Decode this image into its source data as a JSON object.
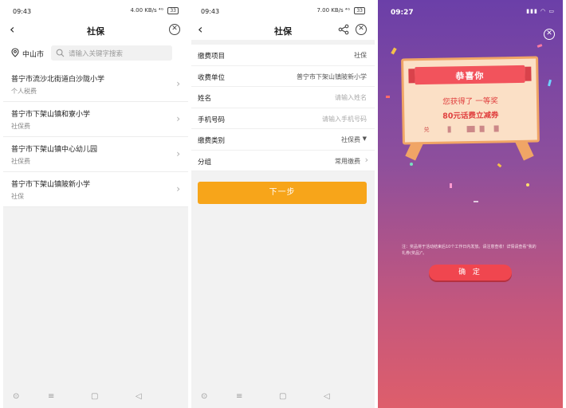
{
  "screen1": {
    "status": {
      "time": "09:43",
      "signal": "4.00 KB/s  ⁴ᴳ",
      "battery": "33"
    },
    "header": {
      "title": "社保"
    },
    "search": {
      "location": "中山市",
      "placeholder": "请输入关键字搜索"
    },
    "items": [
      {
        "title": "普宁市流沙北街道白沙陇小学",
        "subtitle": "个人税费"
      },
      {
        "title": "普宁市下架山镇和寮小学",
        "subtitle": "社保费"
      },
      {
        "title": "普宁市下架山镇中心幼儿园",
        "subtitle": "社保费"
      },
      {
        "title": "普宁市下架山镇陂新小学",
        "subtitle": "社保"
      }
    ]
  },
  "screen2": {
    "status": {
      "time": "09:43",
      "signal": "7.00 KB/s  ⁴ᴳ",
      "battery": "33"
    },
    "header": {
      "title": "社保"
    },
    "form": {
      "item_label": "缴费项目",
      "item_value": "社保",
      "unit_label": "收费单位",
      "unit_value": "普宁市下架山镇陂新小学",
      "name_label": "姓名",
      "name_placeholder": "请输入姓名",
      "phone_label": "手机号码",
      "phone_placeholder": "请输入手机号码",
      "type_label": "缴费类别",
      "type_value": "社保费",
      "group_label": "分组",
      "group_value": "常用缴费"
    },
    "next_button": "下一步"
  },
  "screen3": {
    "status": {
      "time": "09:27"
    },
    "card": {
      "title": "恭喜你",
      "line1": "您获得了  一等奖",
      "line2": "80元话费立减券",
      "code_prefix": "兑"
    },
    "notice": "注：奖品将于活动结束后10个工作日内发放。请注意查收！详情请查看\"我的礼券(奖品)\"。",
    "confirm_button": "确 定"
  },
  "colors": {
    "accent_orange": "#f7a51a",
    "prize_red": "#f2535c",
    "gradient_top": "#6b3fa8",
    "gradient_bottom": "#de5e6b"
  },
  "icons": [
    "back-arrow-icon",
    "close-circle-icon",
    "location-pin-icon",
    "search-icon",
    "chevron-right-icon",
    "share-icon",
    "caret-down-icon",
    "home-icon",
    "menu-icon",
    "recents-icon"
  ]
}
